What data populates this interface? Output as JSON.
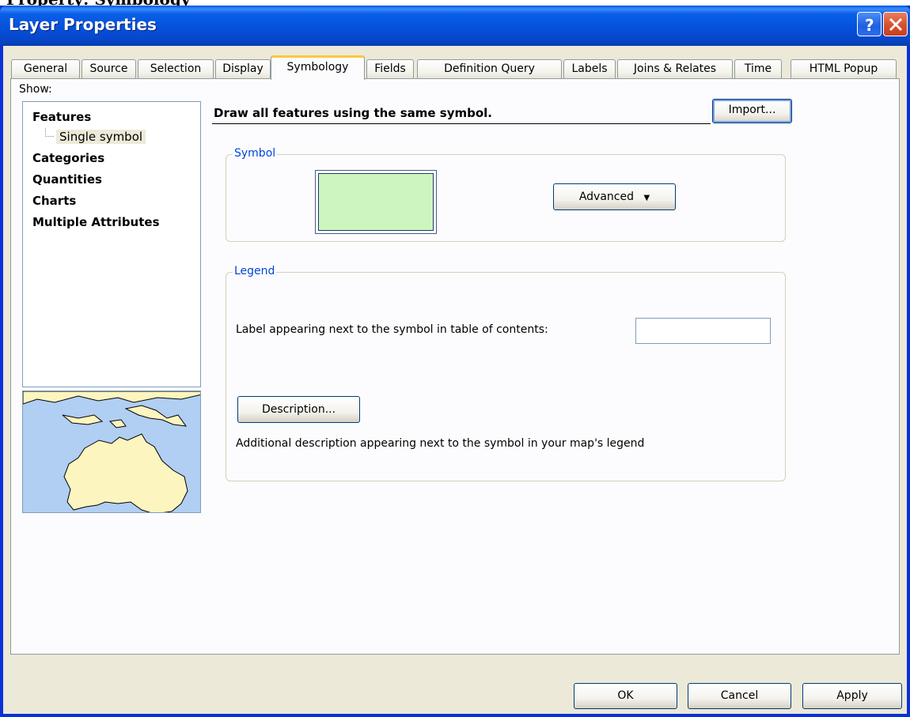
{
  "top_fragment_text": "Property: Symbology",
  "window": {
    "title": "Layer Properties",
    "help_button_glyph": "?",
    "close_button_glyph": "X"
  },
  "tabs": [
    {
      "label": "General",
      "active": false
    },
    {
      "label": "Source",
      "active": false
    },
    {
      "label": "Selection",
      "active": false
    },
    {
      "label": "Display",
      "active": false
    },
    {
      "label": "Symbology",
      "active": true
    },
    {
      "label": "Fields",
      "active": false
    },
    {
      "label": "Definition Query",
      "active": false
    },
    {
      "label": "Labels",
      "active": false
    },
    {
      "label": "Joins & Relates",
      "active": false
    },
    {
      "label": "Time",
      "active": false
    },
    {
      "label": "HTML Popup",
      "active": false
    }
  ],
  "show": {
    "label": "Show:",
    "tree": [
      {
        "label": "Features",
        "bold": true
      },
      {
        "label": "Single symbol",
        "bold": false,
        "selected": true
      },
      {
        "label": "Categories",
        "bold": true
      },
      {
        "label": "Quantities",
        "bold": true
      },
      {
        "label": "Charts",
        "bold": true
      },
      {
        "label": "Multiple Attributes",
        "bold": true
      }
    ]
  },
  "main": {
    "description": "Draw all features using the same symbol.",
    "import_label": "Import...",
    "symbol_group": {
      "title": "Symbol",
      "swatch_color": "#ccf5c0",
      "advanced_label": "Advanced"
    },
    "legend_group": {
      "title": "Legend",
      "label_prompt": "Label appearing next to the symbol in table of contents:",
      "label_value": "",
      "description_button": "Description...",
      "description_note": "Additional description appearing next to the symbol in your map's legend"
    }
  },
  "footer": {
    "ok_label": "OK",
    "cancel_label": "Cancel",
    "apply_label": "Apply"
  },
  "colors": {
    "titlebar": "#0a5fe8",
    "dialog_bg": "#ece9d8",
    "group_title": "#0046d5",
    "map_water": "#b1cef3",
    "map_land": "#fcf5c0"
  }
}
